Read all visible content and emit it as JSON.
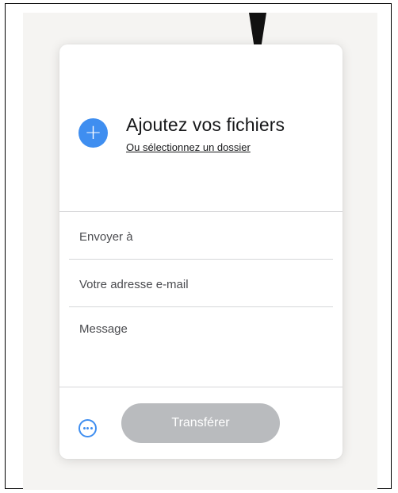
{
  "upload": {
    "title": "Ajoutez vos fichiers",
    "folder_link": "Ou sélectionnez un dossier"
  },
  "form": {
    "send_to_placeholder": "Envoyer à",
    "email_placeholder": "Votre adresse e-mail",
    "message_placeholder": "Message"
  },
  "actions": {
    "transfer_label": "Transférer"
  },
  "colors": {
    "accent": "#3f8ef0",
    "button_disabled": "#b9bbbe",
    "backdrop": "#f5f4f2"
  },
  "icons": {
    "add": "plus-icon",
    "more": "ellipsis-icon"
  }
}
